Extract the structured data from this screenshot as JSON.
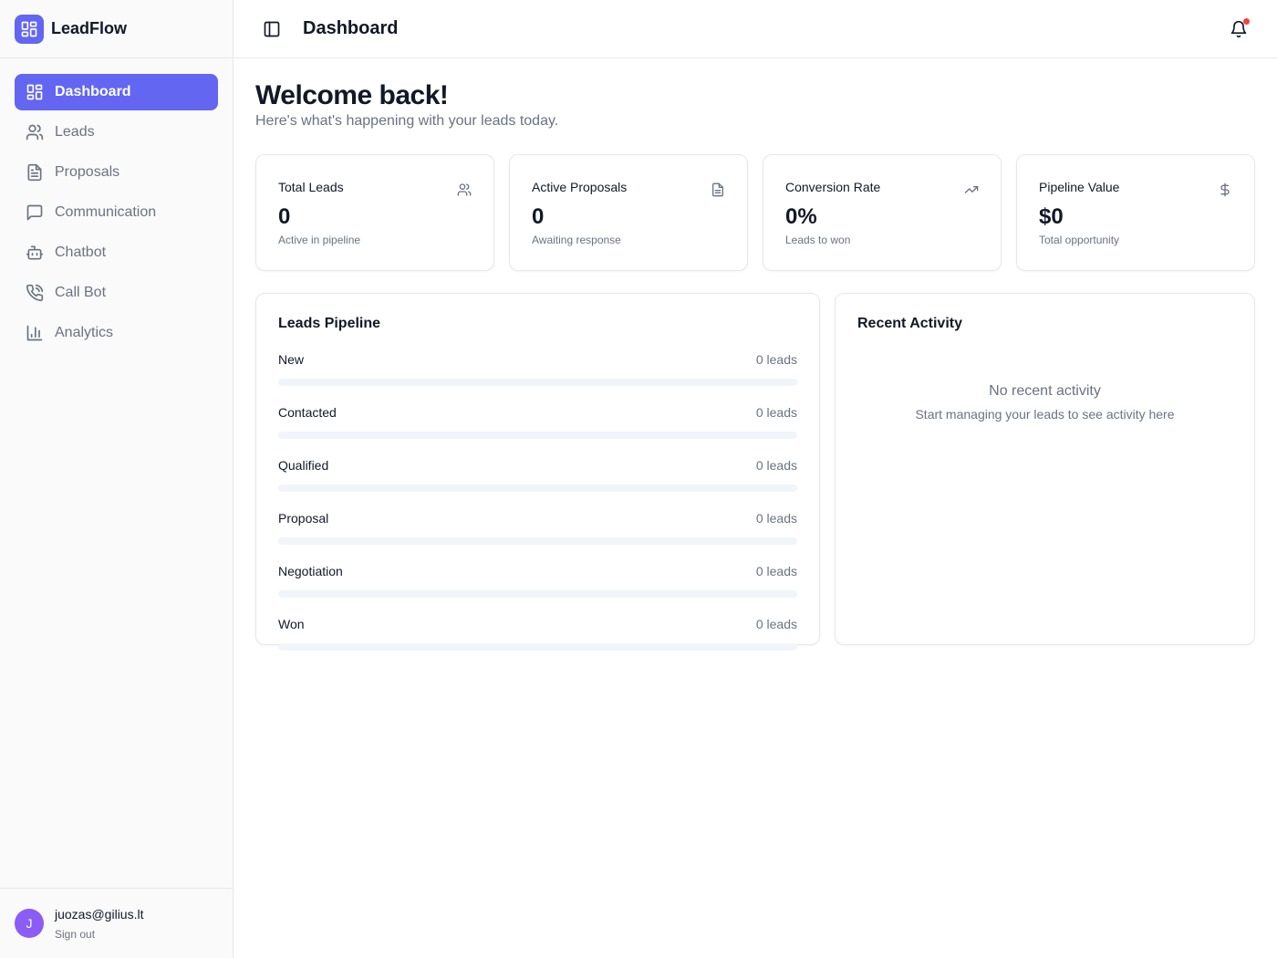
{
  "app": {
    "name": "LeadFlow"
  },
  "sidebar": {
    "items": [
      {
        "label": "Dashboard",
        "icon": "dashboard-icon",
        "active": true
      },
      {
        "label": "Leads",
        "icon": "users-icon"
      },
      {
        "label": "Proposals",
        "icon": "file-text-icon"
      },
      {
        "label": "Communication",
        "icon": "message-square-icon"
      },
      {
        "label": "Chatbot",
        "icon": "bot-icon"
      },
      {
        "label": "Call Bot",
        "icon": "phone-call-icon"
      },
      {
        "label": "Analytics",
        "icon": "bar-chart-icon"
      }
    ],
    "user": {
      "initial": "J",
      "email": "juozas@gilius.lt",
      "signout": "Sign out"
    }
  },
  "header": {
    "title": "Dashboard",
    "notification_dot": true
  },
  "main": {
    "welcome": "Welcome back!",
    "subtitle": "Here's what's happening with your leads today.",
    "stats": [
      {
        "title": "Total Leads",
        "value": "0",
        "sub": "Active in pipeline",
        "icon": "users-icon"
      },
      {
        "title": "Active Proposals",
        "value": "0",
        "sub": "Awaiting response",
        "icon": "file-text-icon"
      },
      {
        "title": "Conversion Rate",
        "value": "0%",
        "sub": "Leads to won",
        "icon": "trending-up-icon"
      },
      {
        "title": "Pipeline Value",
        "value": "$0",
        "sub": "Total opportunity",
        "icon": "dollar-icon"
      }
    ],
    "pipeline": {
      "title": "Leads Pipeline",
      "stages": [
        {
          "name": "New",
          "count": "0 leads",
          "fraction": 0
        },
        {
          "name": "Contacted",
          "count": "0 leads",
          "fraction": 0
        },
        {
          "name": "Qualified",
          "count": "0 leads",
          "fraction": 0
        },
        {
          "name": "Proposal",
          "count": "0 leads",
          "fraction": 0
        },
        {
          "name": "Negotiation",
          "count": "0 leads",
          "fraction": 0
        },
        {
          "name": "Won",
          "count": "0 leads",
          "fraction": 0
        }
      ]
    },
    "activity": {
      "title": "Recent Activity",
      "empty_title": "No recent activity",
      "empty_sub": "Start managing your leads to see activity here"
    }
  },
  "colors": {
    "accent": "#6366f1",
    "avatar": "#8b5cf6",
    "notification": "#ef4444"
  }
}
